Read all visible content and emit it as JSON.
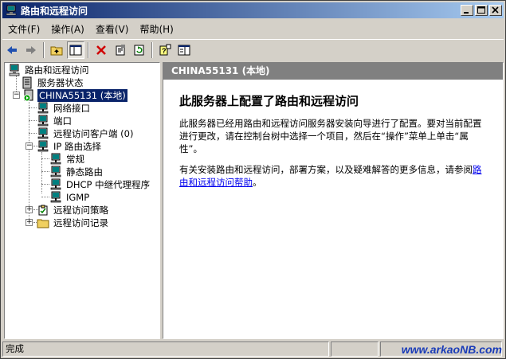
{
  "window": {
    "title": "路由和远程访问"
  },
  "menubar": {
    "items": [
      "文件(F)",
      "操作(A)",
      "查看(V)",
      "帮助(H)"
    ]
  },
  "toolbar": {
    "tools": [
      "back-icon",
      "forward-icon",
      "up-folder-icon",
      "show-tree-icon",
      "delete-icon",
      "properties-icon",
      "refresh-icon",
      "help-icon",
      "console-icon"
    ]
  },
  "tree": {
    "root": "路由和远程访问",
    "server_status": "服务器状态",
    "server": "CHINA55131 (本地)",
    "network_interfaces": "网络接口",
    "ports": "端口",
    "remote_clients": "远程访问客户端 (0)",
    "ip_routing": "IP 路由选择",
    "general": "常规",
    "static_routes": "静态路由",
    "dhcp_relay": "DHCP 中继代理程序",
    "igmp": "IGMP",
    "remote_policies": "远程访问策略",
    "remote_logging": "远程访问记录"
  },
  "right": {
    "header": "CHINA55131 (本地)",
    "title": "此服务器上配置了路由和远程访问",
    "para1": "此服务器已经用路由和远程访问服务器安装向导进行了配置。要对当前配置进行更改，请在控制台树中选择一个项目，然后在“操作”菜单上单击“属性”。",
    "para2_prefix": "有关安装路由和远程访问，部署方案，以及疑难解答的更多信息，请参阅",
    "para2_link": "路由和远程访问帮助",
    "para2_suffix": "。"
  },
  "status": {
    "text": "完成"
  },
  "watermark": "www.arkaoNB.com"
}
